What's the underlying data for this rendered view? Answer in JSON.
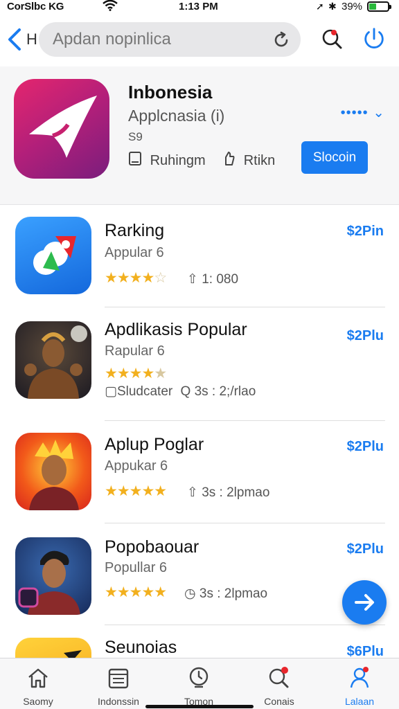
{
  "status": {
    "carrier": "CorSlbc KG",
    "time": "1:13 PM",
    "battery": "39%",
    "battery_level": 0.39
  },
  "header": {
    "back_label": "H",
    "search_placeholder": "Apdan nopinlica"
  },
  "hero": {
    "title": "Inbonesia",
    "subtitle": "Applcnasia (i)",
    "price": "S9",
    "meta_1": "Ruhingm",
    "meta_2": "Rtikn",
    "button": "Slocoin"
  },
  "apps": [
    {
      "title": "Rarking",
      "subtitle": "Appular 6",
      "rating": 4.5,
      "stars": "★★★★",
      "star_half": "☆",
      "meta": "1: 080",
      "meta_icon": "thumb-icon",
      "price": "$2Pin"
    },
    {
      "title": "Apdlikasis Popular",
      "subtitle": "Rapular 6",
      "rating": 4.5,
      "stars": "★★★★",
      "star_half": "★",
      "meta_a": "Sludcater",
      "meta_b": "3s : 2;/rlao",
      "price": "$2Plu"
    },
    {
      "title": "Aplup Poglar",
      "subtitle": "Appukar 6",
      "rating": 5,
      "stars": "★★★★★",
      "star_half": "",
      "meta": "3s : 2lpmao",
      "meta_icon": "thumb-icon",
      "price": "$2Plu"
    },
    {
      "title": "Popobaouar",
      "subtitle": "Popullar 6",
      "rating": 4.5,
      "stars": "★★★★★",
      "star_half": "",
      "meta": "3s : 2lpmao",
      "meta_icon": "clock-icon",
      "price": "$2Plu"
    },
    {
      "title": "Seunoias",
      "price": "$6Plu"
    }
  ],
  "tabs": [
    {
      "label": "Saomy",
      "icon": "home-icon"
    },
    {
      "label": "Indonssin",
      "icon": "calendar-icon"
    },
    {
      "label": "Tomon",
      "icon": "clock-icon"
    },
    {
      "label": "Conais",
      "icon": "search-icon"
    },
    {
      "label": "Lalaan",
      "icon": "person-icon",
      "active": true
    }
  ],
  "colors": {
    "accent": "#1a7cf0",
    "star": "#f2b01e",
    "hero_icon": "#c7216f"
  }
}
